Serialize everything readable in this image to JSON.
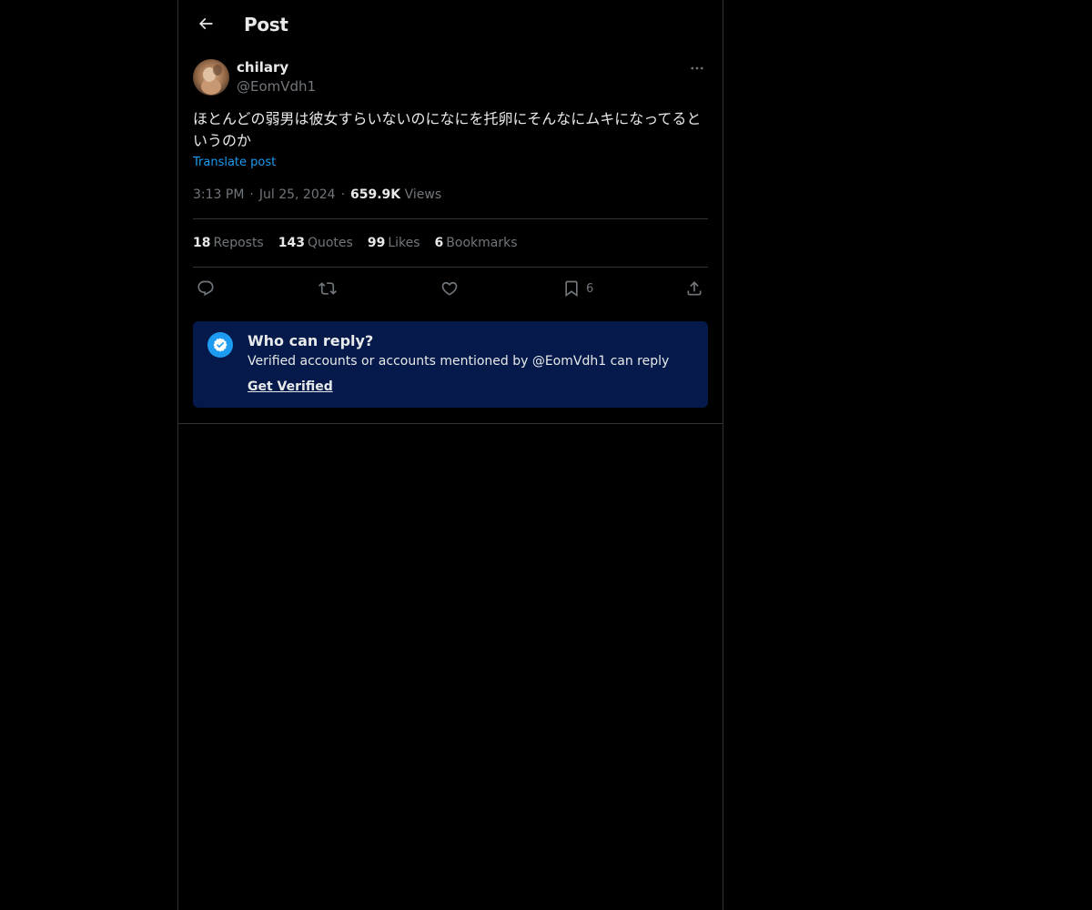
{
  "header": {
    "title": "Post",
    "back_icon": "arrow-left-icon"
  },
  "post": {
    "author_name": "chilary",
    "author_handle": "@EomVdh1",
    "text": "ほとんどの弱男は彼女すらいないのになにを托卵にそんなにムキになってるというのか",
    "translate_label": "Translate post",
    "time": "3:13 PM",
    "date": "Jul 25, 2024",
    "views_count": "659.9K",
    "views_label": "Views",
    "separator": "·"
  },
  "stats": {
    "reposts": {
      "count": "18",
      "label": "Reposts"
    },
    "quotes": {
      "count": "143",
      "label": "Quotes"
    },
    "likes": {
      "count": "99",
      "label": "Likes"
    },
    "bookmarks": {
      "count": "6",
      "label": "Bookmarks"
    }
  },
  "actions": {
    "reply_icon": "reply-icon",
    "repost_icon": "repost-icon",
    "like_icon": "heart-icon",
    "bookmark_icon": "bookmark-icon",
    "bookmark_count": "6",
    "share_icon": "share-icon"
  },
  "reply_notice": {
    "title": "Who can reply?",
    "subtitle": "Verified accounts or accounts mentioned by @EomVdh1 can reply",
    "link": "Get Verified",
    "badge_icon": "verified-badge-icon"
  },
  "colors": {
    "background": "#000000",
    "text": "#e7e9ea",
    "muted": "#71767b",
    "accent": "#1d9bf0",
    "border": "#2f3336",
    "notice_bg": "#051a4a"
  }
}
